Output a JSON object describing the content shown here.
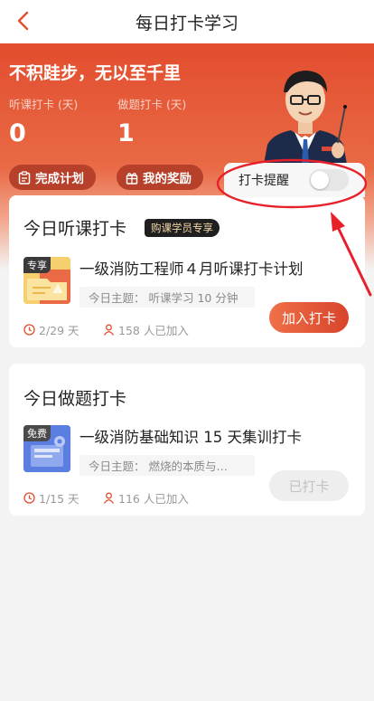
{
  "header": {
    "title": "每日打卡学习",
    "back_icon": "chevron-left-icon"
  },
  "colors": {
    "accent": "#e24d2e",
    "accent_dark": "#b6402a",
    "badge_text": "#f4d6a8",
    "annotation": "#e8202a"
  },
  "hero": {
    "slogan": "不积跬步，无以至千里",
    "stats": [
      {
        "label": "听课打卡 (天)",
        "value": "0"
      },
      {
        "label": "做题打卡 (天)",
        "value": "1"
      }
    ],
    "buttons": [
      {
        "label": "完成计划",
        "icon": "clipboard-icon"
      },
      {
        "label": "我的奖励",
        "icon": "gift-icon"
      }
    ]
  },
  "reminder": {
    "label": "打卡提醒",
    "enabled": false
  },
  "lesson_card": {
    "title": "今日听课打卡",
    "badge": "购课学员专享",
    "thumb_tag": "专享",
    "course": "一级消防工程师４月听课打卡计划",
    "topic": "今日主题：  听课学习 10 分钟",
    "progress": "2/29 天",
    "joined": "158 人已加入",
    "button": "加入打卡"
  },
  "quiz_card": {
    "title": "今日做题打卡",
    "thumb_tag": "免费",
    "course": "一级消防基础知识 15 天集训打卡",
    "topic": "今日主题：  燃烧的本质与…",
    "progress": "1/15 天",
    "joined": "116 人已加入",
    "button": "已打卡"
  }
}
